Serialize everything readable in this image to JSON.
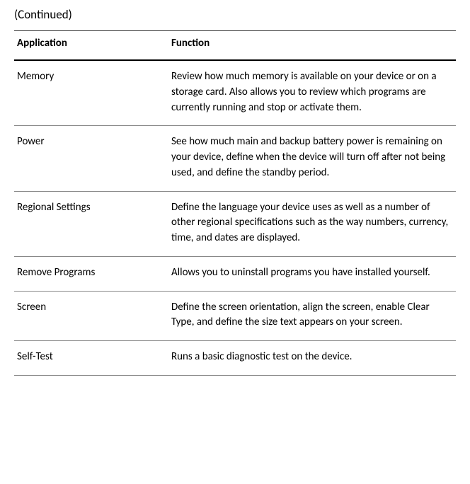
{
  "continued_label": "(Continued)",
  "headers": {
    "application": "Application",
    "function": "Function"
  },
  "rows": [
    {
      "application": "Memory",
      "function": "Review how much memory is available on your device or on a storage card. Also allows you to review which programs are currently running and stop or activate them."
    },
    {
      "application": "Power",
      "function": "See how much main and backup battery power is remaining on your device, define when the device will turn off after not being used, and define the standby period."
    },
    {
      "application": "Regional Settings",
      "function": "Define the language your device uses as well as a number of other regional specifications such as the way numbers, currency, time, and dates are displayed."
    },
    {
      "application": "Remove Programs",
      "function": "Allows you to uninstall programs you have installed yourself."
    },
    {
      "application": "Screen",
      "function": "Define the screen orientation, align the screen, enable Clear Type, and define the size text appears on your screen."
    },
    {
      "application": "Self-Test",
      "function": "Runs a basic diagnostic test on the device."
    }
  ]
}
